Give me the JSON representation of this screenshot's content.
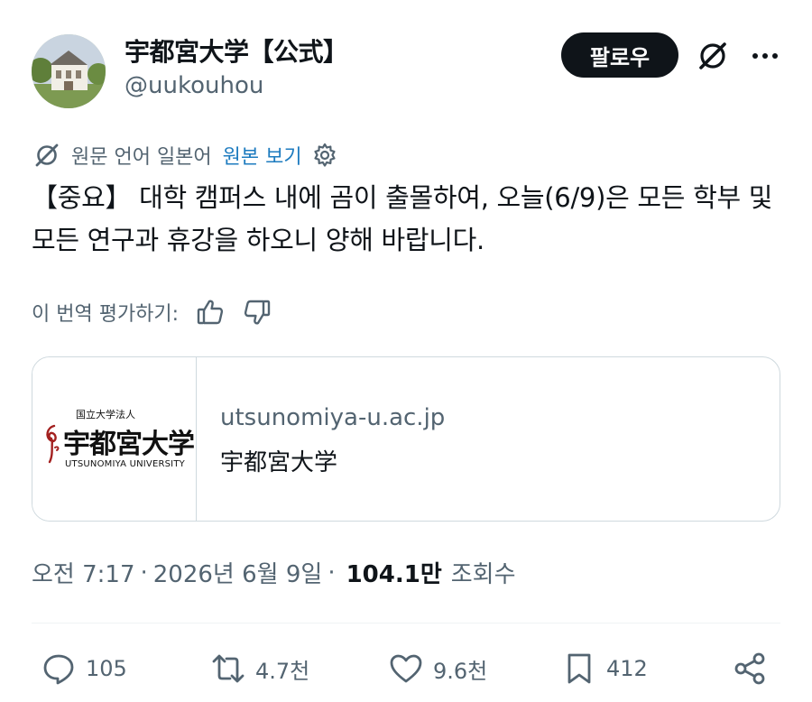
{
  "account": {
    "display_name": "宇都宮大学【公式】",
    "handle": "@uukouhou",
    "follow_label": "팔로우"
  },
  "translation": {
    "source_language": "원문 언어 일본어",
    "show_original": "원본 보기"
  },
  "tweet": {
    "text": "【중요】 대학 캠퍼스 내에 곰이 출몰하여, 오늘(6/9)은 모든 학부 및 모든 연구과 휴강을 하오니 양해 바랍니다."
  },
  "rating": {
    "label": "이 번역 평가하기:"
  },
  "link_card": {
    "logo_small_text": "国立大学法人",
    "logo_main_text": "宇都宮大学",
    "logo_english_text": "UTSUNOMIYA UNIVERSITY",
    "domain": "utsunomiya-u.ac.jp",
    "title": "宇都宮大学"
  },
  "meta": {
    "time": "오전 7:17",
    "separator": "·",
    "date": "2026년 6월 9일",
    "views_count": "104.1만",
    "views_label": "조회수"
  },
  "actions": {
    "replies": "105",
    "reposts": "4.7천",
    "likes": "9.6천",
    "bookmarks": "412"
  },
  "colors": {
    "text_primary": "#0f1419",
    "text_secondary": "#536471",
    "link": "#1d7bbf",
    "border": "#cfd9de"
  }
}
